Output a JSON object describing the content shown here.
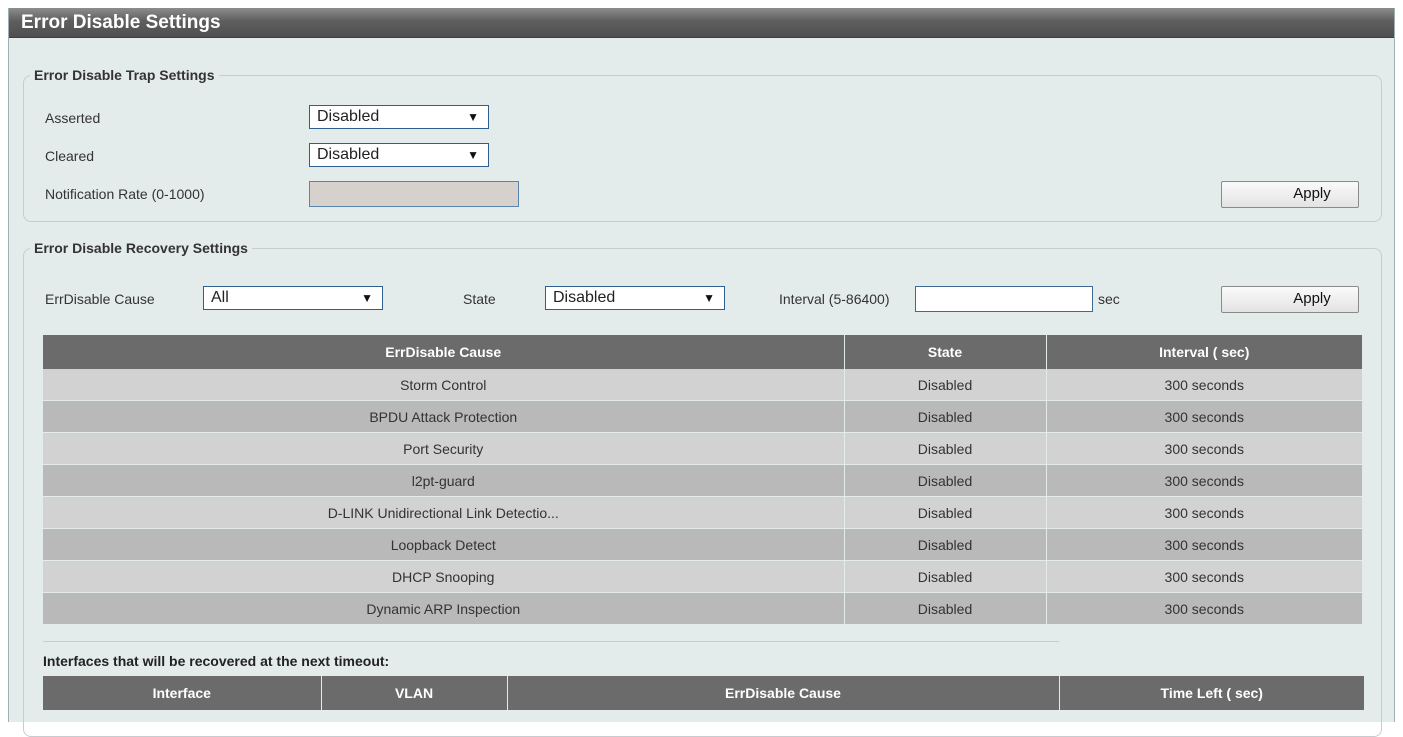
{
  "page": {
    "title": "Error Disable Settings"
  },
  "trap": {
    "legend": "Error Disable Trap Settings",
    "asserted_label": "Asserted",
    "asserted_value": "Disabled",
    "cleared_label": "Cleared",
    "cleared_value": "Disabled",
    "rate_label": "Notification Rate (0-1000)",
    "rate_value": "",
    "apply_label": "Apply"
  },
  "recovery": {
    "legend": "Error Disable Recovery Settings",
    "cause_label": "ErrDisable Cause",
    "cause_value": "All",
    "state_label": "State",
    "state_value": "Disabled",
    "interval_label": "Interval (5-86400)",
    "interval_value": "",
    "interval_unit": "sec",
    "apply_label": "Apply",
    "table": {
      "headers": [
        "ErrDisable Cause",
        "State",
        "Interval ( sec)"
      ],
      "rows": [
        [
          "Storm Control",
          "Disabled",
          "300 seconds"
        ],
        [
          "BPDU Attack Protection",
          "Disabled",
          "300 seconds"
        ],
        [
          "Port Security",
          "Disabled",
          "300 seconds"
        ],
        [
          "l2pt-guard",
          "Disabled",
          "300 seconds"
        ],
        [
          "D-LINK Unidirectional Link Detectio...",
          "Disabled",
          "300 seconds"
        ],
        [
          "Loopback Detect",
          "Disabled",
          "300 seconds"
        ],
        [
          "DHCP Snooping",
          "Disabled",
          "300 seconds"
        ],
        [
          "Dynamic ARP Inspection",
          "Disabled",
          "300 seconds"
        ]
      ]
    }
  },
  "interfaces": {
    "note": "Interfaces that will be recovered at the next timeout:",
    "headers": [
      "Interface",
      "VLAN",
      "ErrDisable Cause",
      "Time Left ( sec)"
    ]
  },
  "colors": {
    "panel_bg": "#e4eceb",
    "header_bg": "#6b6b6b",
    "row_light": "#d2d2d2",
    "row_dark": "#b9b9b9"
  },
  "icons": {
    "dropdown": "dropdown-arrow-icon"
  }
}
